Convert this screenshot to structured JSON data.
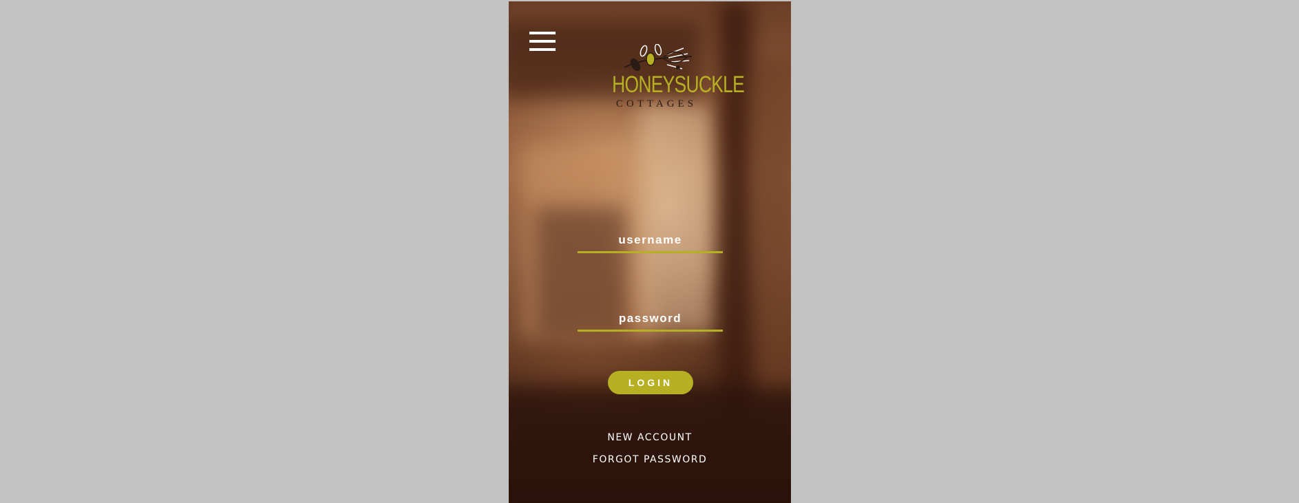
{
  "brand": {
    "name": "HONEYSUCKLE",
    "subtitle": "COTTAGES",
    "accent_color": "#b6b022"
  },
  "header": {
    "menu_icon": "hamburger-menu-icon"
  },
  "login_form": {
    "username": {
      "placeholder": "username",
      "value": ""
    },
    "password": {
      "placeholder": "password",
      "value": ""
    },
    "login_label": "LOGIN"
  },
  "links": {
    "new_account": "NEW ACCOUNT",
    "forgot_password": "FORGOT PASSWORD"
  }
}
